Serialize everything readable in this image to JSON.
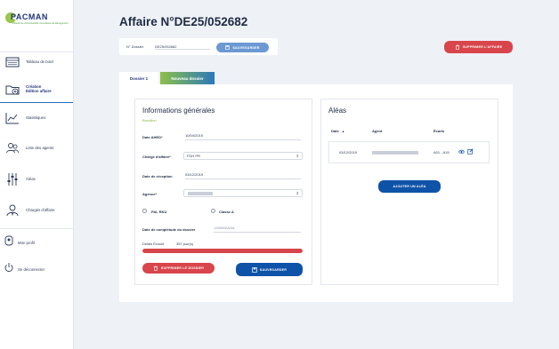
{
  "app": {
    "logo_name": "PACMAN",
    "logo_tagline": "Plateforme d'Accessibilité Centralisée de Management"
  },
  "sidebar": {
    "items": [
      {
        "label": "Tableau de bord",
        "icon": "dashboard-icon"
      },
      {
        "label": "Création\nÉdition affaire",
        "icon": "folder-plus-icon",
        "active": true
      },
      {
        "label": "Statistiques",
        "icon": "chart-icon"
      },
      {
        "label": "Liste des agents",
        "icon": "users-icon"
      },
      {
        "label": "Aléas",
        "icon": "sliders-icon"
      },
      {
        "label": "Chargés d'affaire",
        "icon": "manager-icon"
      }
    ],
    "profile_label": "Mon profil",
    "logout_label": "Se déconnecter"
  },
  "header": {
    "title": "Affaire N°DE25/052682",
    "dossier_label": "N° Dossier",
    "dossier_value": "DE25/052682",
    "save_label": "SAUVEGARDER",
    "delete_affaire_label": "SUPPRIMER L'AFFAIRE"
  },
  "tabs": [
    {
      "label": "Dossier 1",
      "active": true
    },
    {
      "label": "Nouveau dossier",
      "active": false
    }
  ],
  "infos": {
    "title": "Informations générales",
    "status": "Brouillon",
    "fields": {
      "date_ahed_label": "Date AHED*",
      "date_ahed_value": "10/04/2019",
      "charge_label": "Chargé d'affaire*",
      "charge_value": "FDH PR",
      "date_reception_label": "Date de réception",
      "date_reception_value": "03/12/2019",
      "agence_label": "Agence*",
      "pal_rku_label": "PAL RKU",
      "classe_a_label": "Classe A",
      "date_completude_label": "Date de complétude du dossier",
      "date_completude_placeholder": "JJ/MM/AAAA",
      "delai_label": "Délais Écoulé",
      "delai_value": "357 jour(s)"
    },
    "delay_progress_pct": 100,
    "delete_dossier_label": "SUPPRIMER LE DOSSIER",
    "save_label": "SAUVEGARDER"
  },
  "aleas": {
    "title": "Aléas",
    "columns": [
      "Date",
      "Agent",
      "Écarts"
    ],
    "rows": [
      {
        "date": "03/12/2019",
        "ecarts": "A01 - A15"
      }
    ],
    "add_label": "AJOUTER UN ALÉA"
  },
  "colors": {
    "primary": "#0f53a8",
    "danger": "#d8454b",
    "accent_green": "#8dc04a",
    "light_blue": "#6c99d3"
  }
}
